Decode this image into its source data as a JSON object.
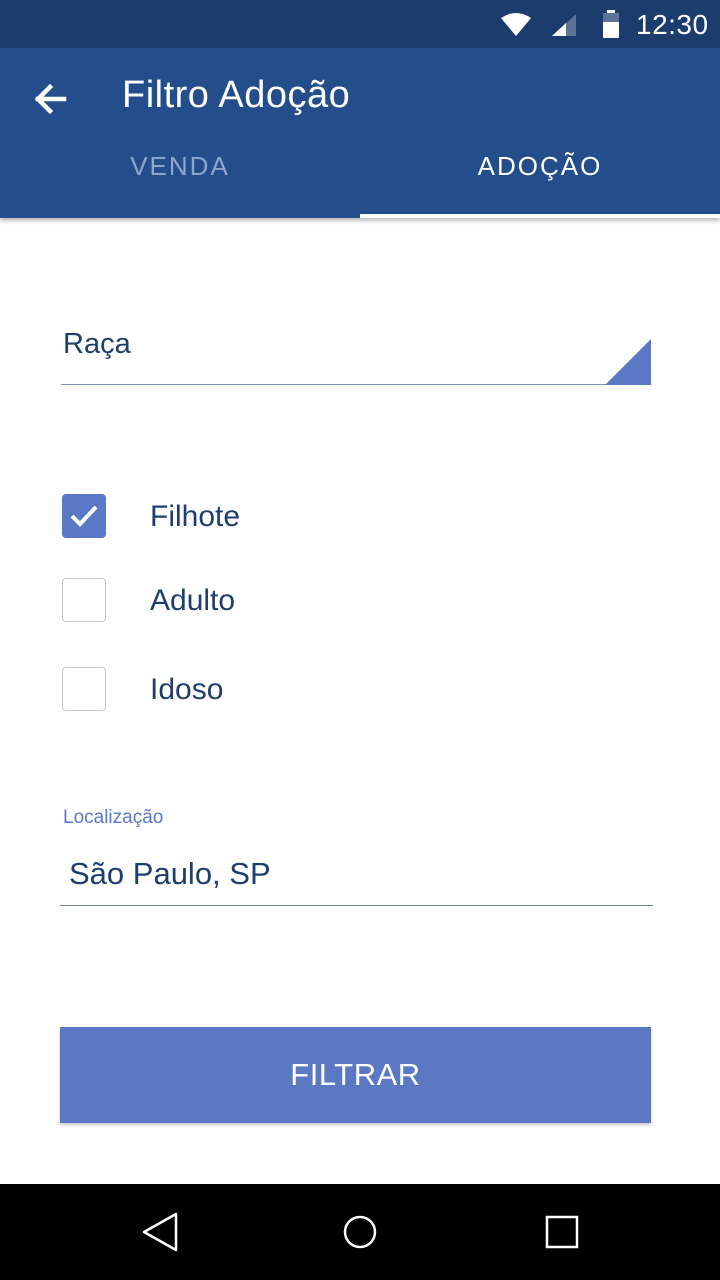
{
  "status_bar": {
    "time": "12:30",
    "icons": [
      "wifi-icon",
      "signal-icon",
      "battery-icon"
    ]
  },
  "app_bar": {
    "title": "Filtro Adoção",
    "back_icon": "arrow-back-icon",
    "tabs": [
      {
        "label": "VENDA",
        "selected": false
      },
      {
        "label": "ADOÇÃO",
        "selected": true
      }
    ]
  },
  "form": {
    "raca": {
      "label": "Raça"
    },
    "age_options": [
      {
        "label": "Filhote",
        "checked": true
      },
      {
        "label": "Adulto",
        "checked": false
      },
      {
        "label": "Idoso",
        "checked": false
      }
    ],
    "location": {
      "label": "Localização",
      "value": "São Paulo, SP"
    },
    "filter_button": {
      "label": "FILTRAR"
    }
  },
  "nav_bar": {
    "icons": [
      "nav-back-icon",
      "nav-home-icon",
      "nav-recent-icon"
    ]
  },
  "colors": {
    "status_bar": "#1c3c6e",
    "app_bar": "#234d8b",
    "accent": "#5a78c6",
    "text": "#1d3e6e",
    "inactive_tab": "#8ea6cb"
  }
}
